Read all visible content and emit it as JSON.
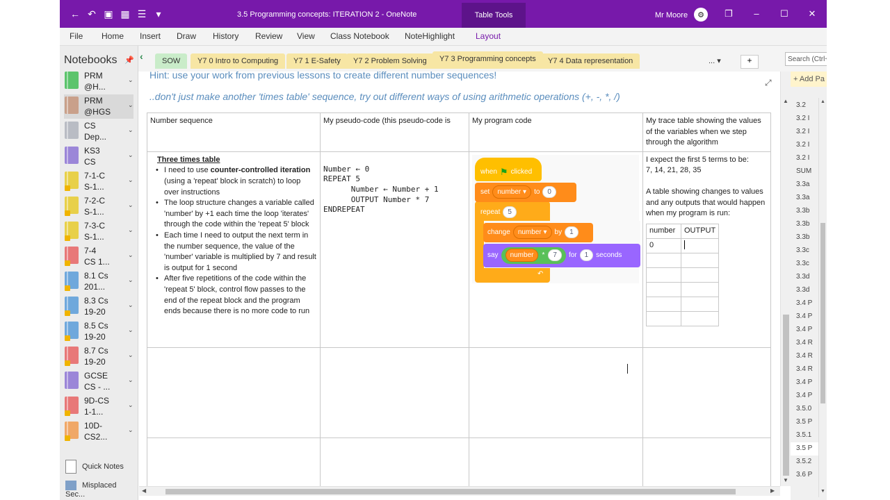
{
  "window": {
    "title": "3.5 Programming concepts:  ITERATION 2  -  OneNote",
    "contextual_tab": "Table Tools",
    "user": "Mr Moore"
  },
  "ribbon": {
    "tabs": [
      "File",
      "Home",
      "Insert",
      "Draw",
      "History",
      "Review",
      "View",
      "Class Notebook",
      "NoteHighlight",
      "Layout"
    ]
  },
  "notebooks": {
    "heading": "Notebooks",
    "items": [
      {
        "label": "PRM\n@H...",
        "color": "#5cc46c",
        "warn": false
      },
      {
        "label": "PRM\n@HGS",
        "color": "#c9a08a",
        "warn": false
      },
      {
        "label": "CS\nDep...",
        "color": "#b9bcc4",
        "warn": false
      },
      {
        "label": "KS3\nCS",
        "color": "#9b86d8",
        "warn": false
      },
      {
        "label": "7-1-C\nS-1...",
        "color": "#e8d04a",
        "warn": true
      },
      {
        "label": "7-2-C\nS-1...",
        "color": "#e8d04a",
        "warn": true
      },
      {
        "label": "7-3-C\nS-1...",
        "color": "#e8d04a",
        "warn": true
      },
      {
        "label": "7-4\nCS 1...",
        "color": "#e87878",
        "warn": true
      },
      {
        "label": "8.1 Cs\n201...",
        "color": "#6fa8dc",
        "warn": true
      },
      {
        "label": "8.3 Cs\n19-20",
        "color": "#6fa8dc",
        "warn": true
      },
      {
        "label": "8.5 Cs\n19-20",
        "color": "#6fa8dc",
        "warn": true
      },
      {
        "label": "8.7 Cs\n19-20",
        "color": "#e87878",
        "warn": true
      },
      {
        "label": "GCSE\nCS - ...",
        "color": "#9b86d8",
        "warn": false
      },
      {
        "label": "9D-CS\n1-1...",
        "color": "#e87878",
        "warn": true
      },
      {
        "label": "10D-\nCS2...",
        "color": "#f0a868",
        "warn": true
      }
    ],
    "quick_notes": "Quick Notes",
    "misplaced": "Misplaced Sec..."
  },
  "sections": {
    "tabs": [
      {
        "label": "SOW",
        "color": "#c9ecc9"
      },
      {
        "label": "Y7 0 Intro to Computing",
        "color": "#f7e6a4"
      },
      {
        "label": "Y7 1 E-Safety",
        "color": "#f7e6a4"
      },
      {
        "label": "Y7 2 Problem Solving",
        "color": "#f7e6a4"
      },
      {
        "label": "Y7 3 Programming concepts",
        "color": "#f7e6a4"
      },
      {
        "label": "Y7 4 Data representation",
        "color": "#f7e6a4"
      }
    ],
    "more": "...",
    "search_placeholder": "Search (Ctrl+E)"
  },
  "page": {
    "hint1": "Hint: use your work from previous lessons to create different number sequences!",
    "hint2": "..don't just make another 'times table' sequence, try out different ways of using arithmetic operations (+, -, *, /)",
    "table": {
      "headers": [
        "Number sequence",
        "My pseudo-code (this pseudo-code is",
        "My program code",
        "My trace table showing the values of the variables when we step through the algorithm"
      ],
      "sequence_title": "Three times table",
      "bullets": [
        {
          "pre": "I need to use ",
          "bold": "counter-controlled iteration",
          "post": " (using a 'repeat' block in scratch) to loop over instructions"
        },
        {
          "pre": "The loop structure changes a variable called 'number'  by +1 each time the loop 'iterates' through the code within the 'repeat 5' block",
          "bold": "",
          "post": ""
        },
        {
          "pre": "Each time I need to output the next term in the number sequence, the value of the 'number' variable is multiplied by 7 and result is output for 1 second",
          "bold": "",
          "post": ""
        },
        {
          "pre": "After five repetitions of the code within the 'repeat 5' block, control flow passes to the end of the repeat block and the program ends because there is no more code to run",
          "bold": "",
          "post": ""
        }
      ],
      "pseudocode": "Number ← 0\nREPEAT 5\n      Number ← Number + 1\n      OUTPUT Number * 7\nENDREPEAT",
      "scratch": {
        "when": "when",
        "clicked": "clicked",
        "set": "set",
        "var": "number",
        "to": "to",
        "init": "0",
        "repeat": "repeat",
        "times": "5",
        "change": "change",
        "by": "by",
        "step": "1",
        "say": "say",
        "op": "*",
        "mult": "7",
        "for": "for",
        "secs": "1",
        "seconds": "seconds"
      },
      "expect": "I expect the first 5 terms to be:",
      "terms": "7, 14, 21, 28, 35",
      "trace_intro": "A table showing changes to values and any outputs that would happen when my program is run:",
      "trace_headers": [
        "number",
        "OUTPUT"
      ],
      "trace_first": "0"
    }
  },
  "pages_panel": {
    "add": "+ Add Pa",
    "items": [
      "3.2",
      "3.2 I",
      "3.2 I",
      "3.2 I",
      "3.2 I",
      "SUM",
      "3.3a",
      "3.3a",
      "3.3b",
      "3.3b",
      "3.3b",
      "3.3c",
      "3.3c",
      "3.3d",
      "3.3d",
      "3.4 P",
      "3.4 P",
      "3.4 P",
      "3.4 R",
      "3.4 R",
      "3.4 R",
      "3.4 P",
      "3.4 P",
      "3.5.0",
      "3.5 P",
      "3.5.1",
      "3.5 P",
      "3.5.2",
      "3.6 P"
    ],
    "selected": 26
  }
}
